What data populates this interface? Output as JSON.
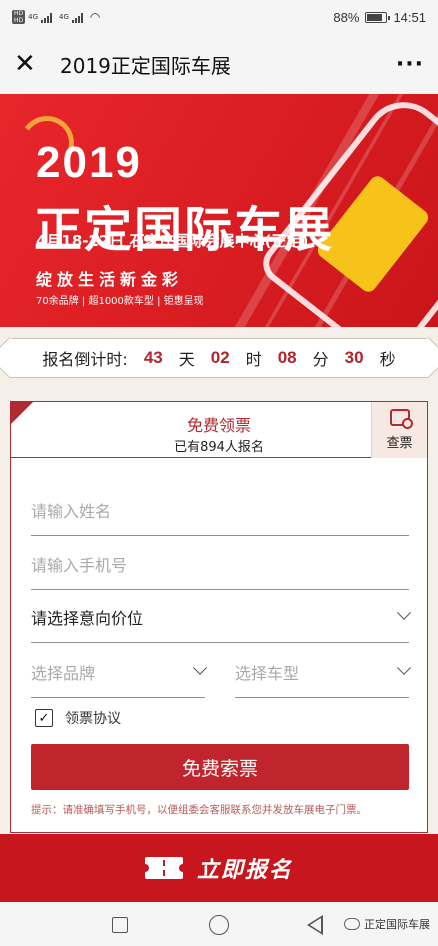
{
  "status_bar": {
    "sim1": "HD",
    "sim2": "HD",
    "network1": "4G",
    "network2": "4G",
    "battery_percent": "88%",
    "time": "14:51"
  },
  "titlebar": {
    "close_icon": "close-icon",
    "title": "2019正定国际车展",
    "more_icon": "more-icon"
  },
  "banner": {
    "year": "2019",
    "title": "正定国际车展",
    "subtitle": "4月18-22日  石家庄国际会展中心(正定)",
    "slogan": "绽放生活新金彩",
    "tagline": "70余品牌 | 超1000款车型 | 钜惠呈现"
  },
  "countdown": {
    "label": "报名倒计时:",
    "days": "43",
    "days_unit": "天",
    "hours": "02",
    "hours_unit": "时",
    "minutes": "08",
    "minutes_unit": "分",
    "seconds": "30",
    "seconds_unit": "秒"
  },
  "form": {
    "title": "免费领票",
    "registered_count": "已有894人报名",
    "check_ticket_label": "查票",
    "name_placeholder": "请输入姓名",
    "phone_placeholder": "请输入手机号",
    "price_select": "请选择意向价位",
    "brand_select": "选择品牌",
    "model_select": "选择车型",
    "agreement_label": "领票协议",
    "agreement_checked": true,
    "submit_label": "免费索票",
    "hint": "提示：请准确填写手机号，以便组委会客服联系您并发放车展电子门票。"
  },
  "cta": {
    "label": "立即报名"
  },
  "watermark": {
    "text": "正定国际车展"
  },
  "colors": {
    "brand_red": "#c8161e",
    "accent_red": "#b12a33",
    "banner_red": "#e8262b",
    "cream": "#f4efe8"
  }
}
